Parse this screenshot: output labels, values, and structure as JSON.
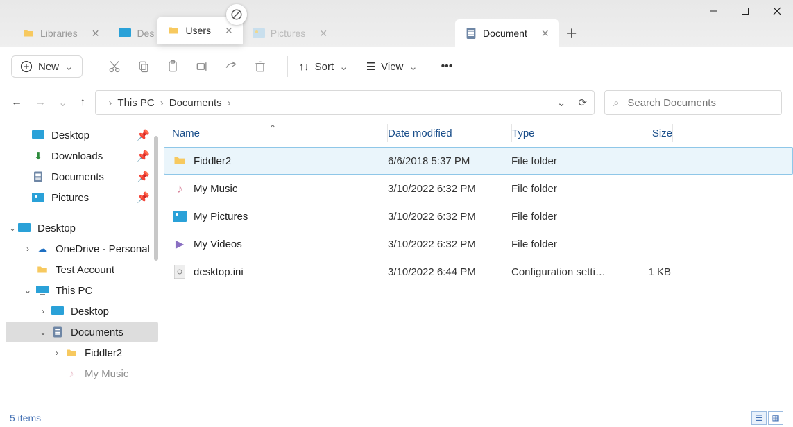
{
  "tabs": [
    {
      "label": "Libraries",
      "icon": "folder"
    },
    {
      "label": "Des",
      "icon": "desktop"
    },
    {
      "label": "Users",
      "icon": "folder",
      "dragging": true
    },
    {
      "label": "Pictures",
      "icon": "pictures"
    },
    {
      "label": "Document",
      "icon": "document",
      "active": true
    }
  ],
  "toolbar": {
    "new_label": "New",
    "sort_label": "Sort",
    "view_label": "View"
  },
  "breadcrumb": {
    "root": "This PC",
    "folder": "Documents"
  },
  "search": {
    "placeholder": "Search Documents"
  },
  "sidebar": {
    "quick": [
      {
        "label": "Desktop",
        "icon": "desktop"
      },
      {
        "label": "Downloads",
        "icon": "downloads"
      },
      {
        "label": "Documents",
        "icon": "documents"
      },
      {
        "label": "Pictures",
        "icon": "pictures"
      }
    ],
    "tree": {
      "desktop": "Desktop",
      "onedrive": "OneDrive - Personal",
      "testacct": "Test Account",
      "thispc": "This PC",
      "pc_desktop": "Desktop",
      "pc_documents": "Documents",
      "fiddler": "Fiddler2",
      "mymusic": "My Music"
    }
  },
  "columns": {
    "name": "Name",
    "date": "Date modified",
    "type": "Type",
    "size": "Size"
  },
  "rows": [
    {
      "name": "Fiddler2",
      "date": "6/6/2018 5:37 PM",
      "type": "File folder",
      "size": "",
      "icon": "folder",
      "selected": true
    },
    {
      "name": "My Music",
      "date": "3/10/2022 6:32 PM",
      "type": "File folder",
      "size": "",
      "icon": "music"
    },
    {
      "name": "My Pictures",
      "date": "3/10/2022 6:32 PM",
      "type": "File folder",
      "size": "",
      "icon": "pictures"
    },
    {
      "name": "My Videos",
      "date": "3/10/2022 6:32 PM",
      "type": "File folder",
      "size": "",
      "icon": "videos"
    },
    {
      "name": "desktop.ini",
      "date": "3/10/2022 6:44 PM",
      "type": "Configuration setti…",
      "size": "1 KB",
      "icon": "ini"
    }
  ],
  "status": {
    "count": "5 items"
  }
}
